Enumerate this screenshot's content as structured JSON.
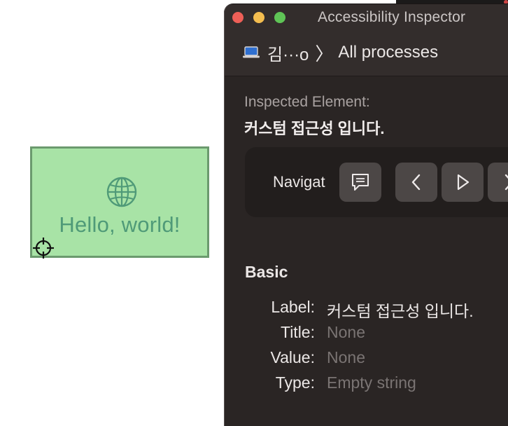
{
  "sample_app": {
    "greeting": "Hello, world!"
  },
  "inspector": {
    "window_title": "Accessibility Inspector",
    "target_device": "김···o",
    "target_separator": "〉",
    "target_scope": "All processes",
    "inspected_label": "Inspected Element:",
    "inspected_value": "커스텀 접근성 입니다.",
    "navigation": {
      "label": "Navigat"
    },
    "basic": {
      "title": "Basic",
      "rows": [
        {
          "key": "Label:",
          "value": "커스텀 접근성 입니다."
        },
        {
          "key": "Title:",
          "value": "None"
        },
        {
          "key": "Value:",
          "value": "None"
        },
        {
          "key": "Type:",
          "value": "Empty string"
        }
      ]
    }
  },
  "colors": {
    "preview_fill": "#a8e3a6",
    "preview_border": "#6b9a6e",
    "preview_text": "#4f9a78",
    "window_bg": "#2a2524",
    "close": "#ee5f57",
    "minimize": "#f4bd4f",
    "maximize": "#5fc456"
  },
  "icons": {
    "globe": "globe-icon",
    "crosshair": "crosshair-icon",
    "laptop": "laptop-icon",
    "speak": "speech-bubble-icon",
    "previous": "chevron-left-icon",
    "play": "play-icon",
    "next": "chevron-right-icon"
  }
}
